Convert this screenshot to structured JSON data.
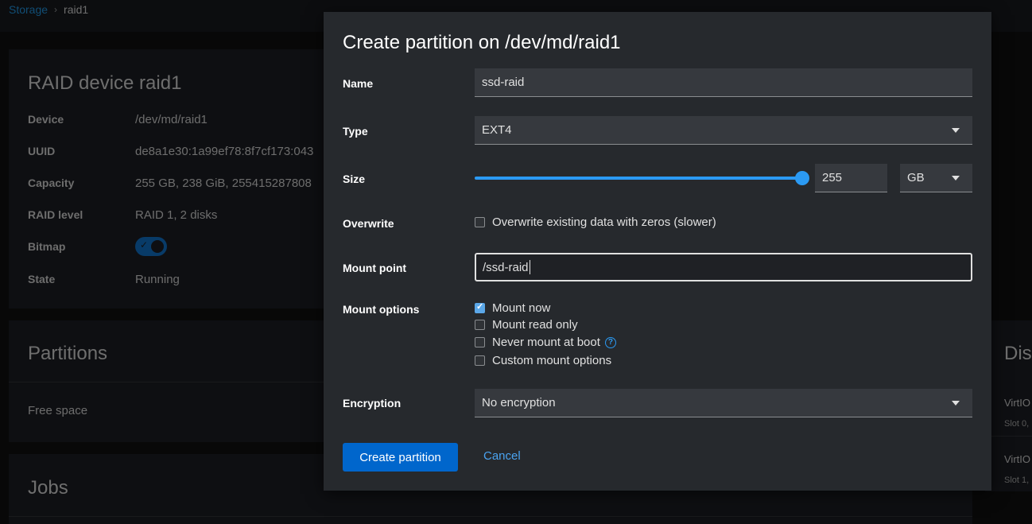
{
  "breadcrumb": {
    "root": "Storage",
    "current": "raid1"
  },
  "raid_card": {
    "title": "RAID device raid1",
    "rows": [
      {
        "key": "Device",
        "value": "/dev/md/raid1"
      },
      {
        "key": "UUID",
        "value": "de8a1e30:1a99ef78:8f7cf173:043"
      },
      {
        "key": "Capacity",
        "value": "255 GB, 238 GiB, 255415287808"
      },
      {
        "key": "RAID level",
        "value": "RAID 1, 2 disks"
      },
      {
        "key": "Bitmap",
        "value": ""
      },
      {
        "key": "State",
        "value": "Running"
      }
    ]
  },
  "partitions_card": {
    "title": "Partitions",
    "free_space": "Free space"
  },
  "jobs_card": {
    "title": "Jobs"
  },
  "disks_card": {
    "title": "Dis",
    "items": [
      {
        "name": "VirtIO",
        "slot": "Slot 0,"
      },
      {
        "name": "VirtIO",
        "slot": "Slot 1,"
      }
    ]
  },
  "modal": {
    "title": "Create partition on /dev/md/raid1",
    "name": {
      "label": "Name",
      "value": "ssd-raid"
    },
    "type": {
      "label": "Type",
      "value": "EXT4"
    },
    "size": {
      "label": "Size",
      "value": "255",
      "unit": "GB",
      "slider_fraction": 1.0
    },
    "overwrite": {
      "label": "Overwrite",
      "option": "Overwrite existing data with zeros (slower)",
      "checked": false
    },
    "mount_point": {
      "label": "Mount point",
      "value": "/ssd-raid"
    },
    "mount_options": {
      "label": "Mount options",
      "items": [
        {
          "label": "Mount now",
          "checked": true
        },
        {
          "label": "Mount read only",
          "checked": false
        },
        {
          "label": "Never mount at boot",
          "checked": false
        },
        {
          "label": "Custom mount options",
          "checked": false
        }
      ]
    },
    "encryption": {
      "label": "Encryption",
      "value": "No encryption"
    },
    "create_button": "Create partition",
    "cancel_button": "Cancel"
  },
  "colors": {
    "accent": "#0066cc",
    "link": "#2b9af3",
    "modal_bg": "#26292d"
  }
}
